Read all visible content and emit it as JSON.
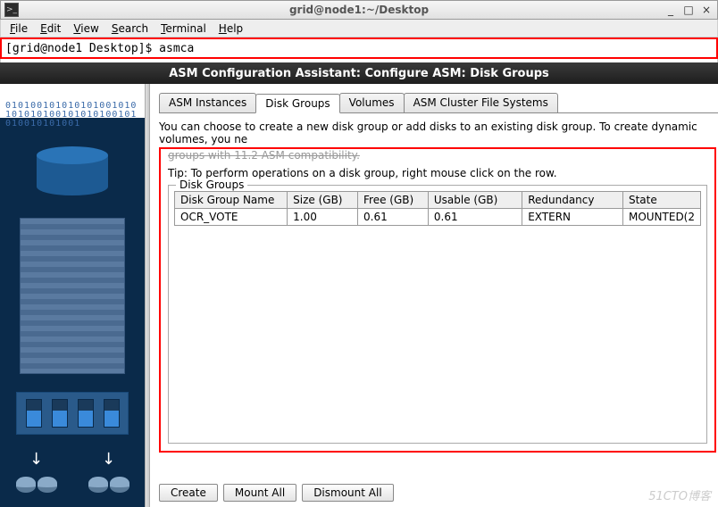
{
  "terminal": {
    "title": "grid@node1:~/Desktop",
    "menus": [
      "File",
      "Edit",
      "View",
      "Search",
      "Terminal",
      "Help"
    ],
    "prompt_line": "[grid@node1 Desktop]$ asmca"
  },
  "asm_window": {
    "title": "ASM Configuration Assistant: Configure ASM: Disk Groups",
    "tabs": [
      {
        "label": "ASM Instances",
        "active": false
      },
      {
        "label": "Disk Groups",
        "active": true
      },
      {
        "label": "Volumes",
        "active": false
      },
      {
        "label": "ASM Cluster File Systems",
        "active": false
      }
    ],
    "instructions_line1": "You can choose to create a new disk group or add disks to an existing disk group. To create dynamic volumes, you ne",
    "instructions_line2_cut": "groups with 11.2 ASM compatibility.",
    "tip": "Tip: To perform operations on a disk group, right mouse click on the row.",
    "fieldset_legend": "Disk Groups",
    "columns": [
      "Disk Group Name",
      "Size (GB)",
      "Free (GB)",
      "Usable (GB)",
      "Redundancy",
      "State"
    ],
    "rows": [
      {
        "name": "OCR_VOTE",
        "size": "1.00",
        "free": "0.61",
        "usable": "0.61",
        "redundancy": "EXTERN",
        "state": "MOUNTED(2"
      }
    ],
    "buttons": {
      "create": "Create",
      "mount_all": "Mount All",
      "dismount_all": "Dismount All"
    }
  },
  "watermark": "51CTO博客"
}
